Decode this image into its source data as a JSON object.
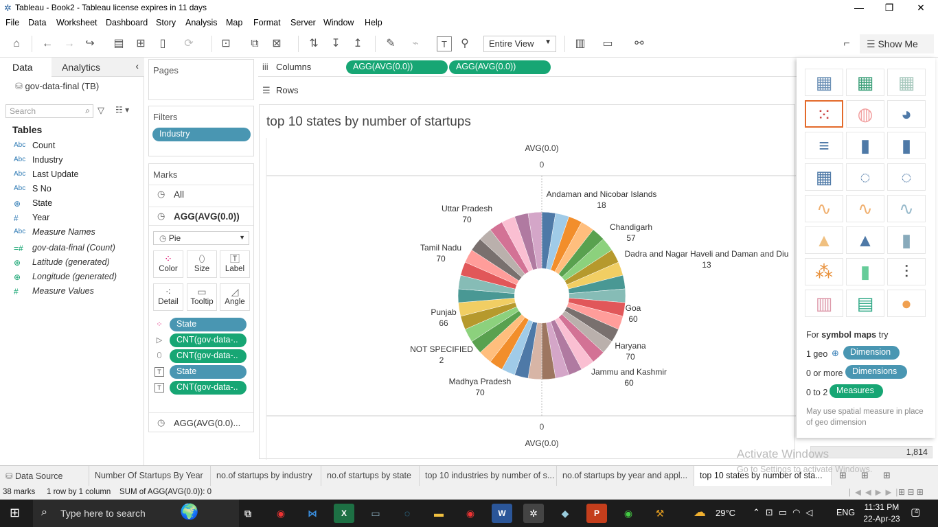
{
  "window": {
    "title": "Tableau - Book2 - Tableau license expires in 11 days",
    "minimize": "—",
    "restore": "❐",
    "close": "✕"
  },
  "menu": [
    "File",
    "Data",
    "Worksheet",
    "Dashboard",
    "Story",
    "Analysis",
    "Map",
    "Format",
    "Server",
    "Window",
    "Help"
  ],
  "toolbar": {
    "fit_dropdown": "Entire View",
    "show_me": "Show Me"
  },
  "data_pane": {
    "tab_data": "Data",
    "tab_analytics": "Analytics",
    "data_source": "gov-data-final (TB)",
    "search_placeholder": "Search",
    "tables_heading": "Tables",
    "fields": [
      {
        "type": "Abc",
        "name": "Count"
      },
      {
        "type": "Abc",
        "name": "Industry"
      },
      {
        "type": "Abc",
        "name": "Last Update"
      },
      {
        "type": "Abc",
        "name": "S No"
      },
      {
        "type": "⊕",
        "name": "State"
      },
      {
        "type": "#",
        "name": "Year"
      },
      {
        "type": "Abc",
        "name": "Measure Names"
      },
      {
        "type": "=#",
        "name": "gov-data-final (Count)"
      },
      {
        "type": "⊕",
        "name": "Latitude (generated)"
      },
      {
        "type": "⊕",
        "name": "Longitude (generated)"
      },
      {
        "type": "#",
        "name": "Measure Values"
      }
    ]
  },
  "shelves": {
    "pages": "Pages",
    "filters": "Filters",
    "filter_pill": "Industry",
    "columns": "Columns",
    "rows": "Rows",
    "column_pills": [
      "AGG(AVG(0.0))",
      "AGG(AVG(0.0))"
    ]
  },
  "marks": {
    "heading": "Marks",
    "all": "All",
    "agg1": "AGG(AVG(0.0))",
    "mark_type": "Pie",
    "buttons": [
      "Color",
      "Size",
      "Label",
      "Detail",
      "Tooltip",
      "Angle"
    ],
    "pills": [
      "State",
      "CNT(gov-data-..",
      "CNT(gov-data-..",
      "State",
      "CNT(gov-data-.."
    ],
    "agg2": "AGG(AVG(0.0)..."
  },
  "view": {
    "title": "top 10 states by number of startups",
    "axis_top_label": "AVG(0.0)",
    "axis_top_tick": "0",
    "axis_bottom_tick": "0",
    "axis_bottom_label": "AVG(0.0)",
    "labels": [
      {
        "name": "Andaman and Nicobar Islands",
        "value": "18"
      },
      {
        "name": "Chandigarh",
        "value": "57"
      },
      {
        "name": "Dadra and Nagar Haveli and Daman and Diu",
        "value": "13"
      },
      {
        "name": "Goa",
        "value": "60"
      },
      {
        "name": "Haryana",
        "value": "70"
      },
      {
        "name": "Jammu and Kashmir",
        "value": "60"
      },
      {
        "name": "Madhya Pradesh",
        "value": "70"
      },
      {
        "name": "NOT SPECIFIED",
        "value": "2"
      },
      {
        "name": "Punjab",
        "value": "66"
      },
      {
        "name": "Tamil Nadu",
        "value": "70"
      },
      {
        "name": "Uttar Pradesh",
        "value": "70"
      }
    ],
    "slice_colors": [
      "#4e79a7",
      "#a0cbe8",
      "#f28e2b",
      "#ffbe7d",
      "#59a14f",
      "#8cd17d",
      "#b6992d",
      "#f1ce63",
      "#499894",
      "#86bcb6",
      "#e15759",
      "#ff9d9a",
      "#79706e",
      "#bab0ac",
      "#d37295",
      "#fabfd2",
      "#b07aa1",
      "#d4a6c8",
      "#9d7660",
      "#d7b5a6",
      "#4e79a7",
      "#a0cbe8",
      "#f28e2b",
      "#ffbe7d",
      "#59a14f",
      "#8cd17d",
      "#b6992d",
      "#f1ce63",
      "#499894",
      "#86bcb6",
      "#e15759",
      "#ff9d9a",
      "#79706e",
      "#bab0ac",
      "#d37295",
      "#fabfd2",
      "#b07aa1",
      "#d4a6c8"
    ]
  },
  "show_me": {
    "hint_prefix": "For",
    "hint_bold": "symbol maps",
    "hint_suffix": "try",
    "req1_count": "1 geo",
    "req1_pill": "Dimension",
    "req2_count": "0 or more",
    "req2_pill": "Dimensions",
    "req3_count": "0 to 2",
    "req3_pill": "Measures",
    "note": "May use spatial measure in place of geo dimension"
  },
  "watermark": {
    "line1": "Activate Windows",
    "line2": "Go to Settings to activate Windows."
  },
  "right_value": "1,814",
  "sheet_tabs": [
    "Data Source",
    "Number Of Startups By Year",
    "no.of startups by industry",
    "no.of startups by state",
    "top 10 industries by number of s...",
    "no.of startups by  year and appl...",
    "top 10 states by number of sta..."
  ],
  "status": {
    "marks": "38 marks",
    "rows_cols": "1 row by 1 column",
    "sum": "SUM of AGG(AVG(0.0)): 0"
  },
  "taskbar": {
    "search_placeholder": "Type here to search",
    "temp": "29°C",
    "lang": "ENG",
    "time": "11:31 PM",
    "date": "22-Apr-23",
    "notif": "4"
  }
}
